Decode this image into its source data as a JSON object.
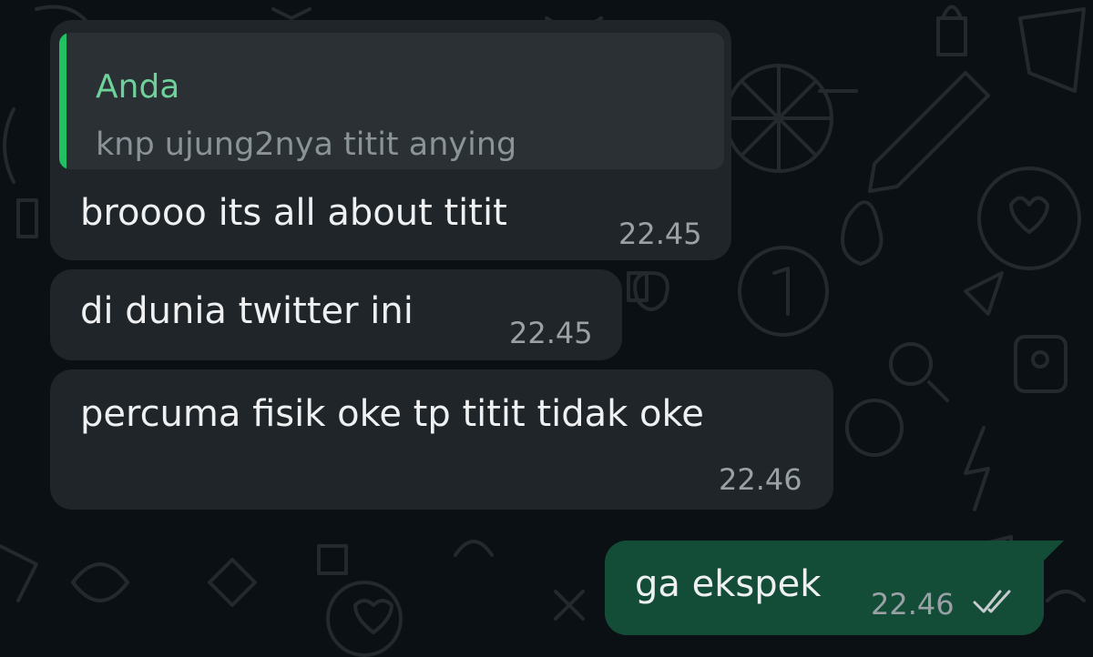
{
  "chat": {
    "messages": [
      {
        "direction": "incoming",
        "quote": {
          "author": "Anda",
          "text": "knp ujung2nya titit anying"
        },
        "text": "broooo its all about titit",
        "time": "22.45"
      },
      {
        "direction": "incoming",
        "text": "di dunia twitter ini",
        "time": "22.45"
      },
      {
        "direction": "incoming",
        "text": "percuma fisik oke tp titit tidak oke",
        "time": "22.46"
      },
      {
        "direction": "outgoing",
        "text": "ga ekspek",
        "time": "22.46",
        "status": "read"
      }
    ]
  },
  "icons": {
    "read_receipt": "double-check-icon"
  },
  "colors": {
    "background": "#0b1014",
    "incoming_bubble": "#1f2529",
    "outgoing_bubble": "#134d37",
    "quote_accent": "#21c063",
    "quote_author": "#6fd19a",
    "read_receipt": "#c8ccce"
  }
}
